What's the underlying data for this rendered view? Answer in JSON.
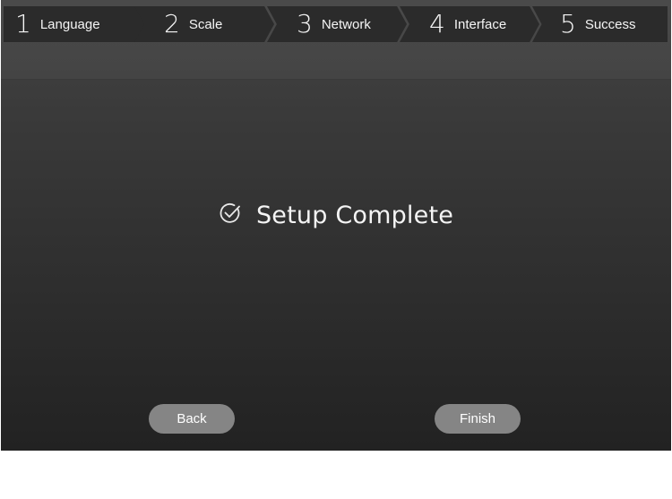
{
  "steps": [
    {
      "number": "1",
      "label": "Language"
    },
    {
      "number": "2",
      "label": "Scale"
    },
    {
      "number": "3",
      "label": "Network"
    },
    {
      "number": "4",
      "label": "Interface"
    },
    {
      "number": "5",
      "label": "Success"
    }
  ],
  "main": {
    "icon": "check-circle-icon",
    "title": "Setup Complete"
  },
  "buttons": {
    "back_label": "Back",
    "finish_label": "Finish"
  },
  "colors": {
    "step_background": "#2b2b2b",
    "button_background": "#858585",
    "text": "#f4f4f4"
  }
}
